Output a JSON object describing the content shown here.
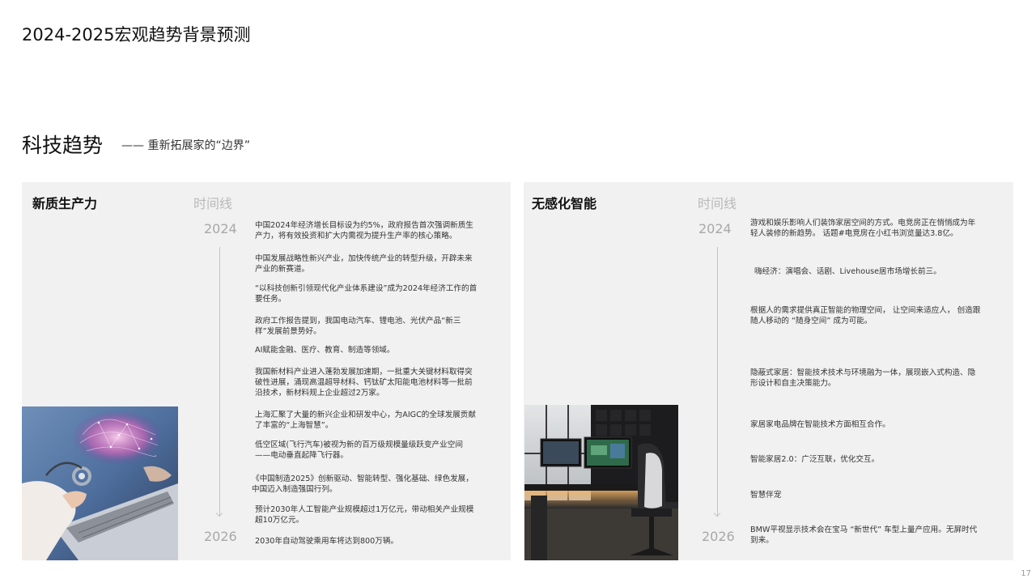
{
  "page": {
    "title": "2024-2025宏观趋势背景预测",
    "section_title": "科技趋势",
    "section_subtitle": "—— 重新拓展家的“边界”",
    "page_number": "17"
  },
  "left_panel": {
    "heading": "新质生产力",
    "timeline_label": "时间线",
    "year_start": "2024",
    "year_end": "2026",
    "entries": [
      "中国2024年经济增长目标设为约5%，政府报告首次强调新质生产力，将有效投资和扩大内需视为提升生产率的核心策略。",
      "中国发展战略性新兴产业，加快传统产业的转型升级，开辟未来产业的新赛道。",
      "“以科技创新引领现代化产业体系建设”成为2024年经济工作的首要任务。",
      "政府工作报告提到，我国电动汽车、锂电池、光伏产品“新三样”发展前景势好。",
      "AI赋能金融、医疗、教育、制造等领域。",
      "我国新材料产业进入蓬勃发展加速期，一批重大关键材料取得突破性进展，涌现高温超导材料、钙钛矿太阳能电池材料等一批前沿技术，新材料规上企业超过2万家。",
      "上海汇聚了大量的新兴企业和研发中心，为AIGC的全球发展贡献了丰富的“上海智慧”。",
      "低空区域(飞行汽车)被视为新的百万级规模量级跃变产业空间——电动垂直起降飞行器。",
      "《中国制造2025》创新驱动、智能转型、强化基础、绿色发展，中国迈入制造强国行列。",
      "预计2030年人工智能产业规模超过1万亿元，带动相关产业规模超10万亿元。",
      "2030年自动驾驶乘用车将达到800万辆。"
    ]
  },
  "right_panel": {
    "heading": "无感化智能",
    "timeline_label": "时间线",
    "year_start": "2024",
    "year_end": "2026",
    "entries": [
      "游戏和娱乐影响人们装饰家居空间的方式。电竞房正在悄悄成为年轻人装修的新趋势。 话题#电竞房在小红书浏览量达3.8亿。",
      "嗨经济：演唱会、话剧、Livehouse居市场增长前三。",
      "根据人的需求提供真正智能的物理空间， 让空间来适应人， 创造跟随人移动的 “随身空间” 成为可能。",
      "隐蔽式家居：智能技术技术与环境融为一体，展现嵌入式构造、隐形设计和自主决策能力。",
      "家居家电品牌在智能技术方面相互合作。",
      "智能家居2.0：广泛互联，优化交互。",
      "智慧伴宠",
      "BMW平视显示技术会在宝马 “新世代” 车型上量产应用。无屏时代到来。"
    ]
  }
}
